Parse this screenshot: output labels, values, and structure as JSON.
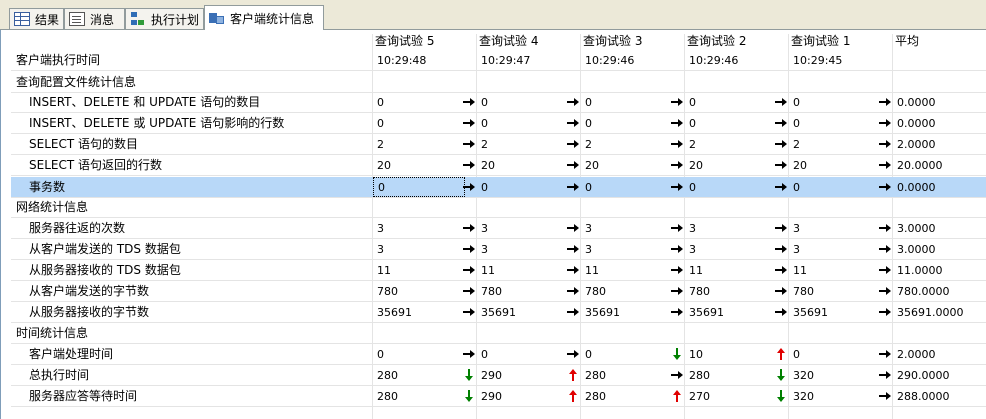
{
  "tabs": [
    {
      "label": "结果",
      "icon": "results-grid-icon"
    },
    {
      "label": "消息",
      "icon": "messages-icon"
    },
    {
      "label": "执行计划",
      "icon": "execution-plan-icon"
    },
    {
      "label": "客户端统计信息",
      "icon": "client-statistics-icon",
      "active": true
    }
  ],
  "columns": [
    "查询试验 5",
    "查询试验 4",
    "查询试验 3",
    "查询试验 2",
    "查询试验 1",
    "平均"
  ],
  "rows": [
    {
      "type": "top",
      "label": "客户端执行时间",
      "values": [
        "10:29:48",
        "10:29:47",
        "10:29:46",
        "10:29:46",
        "10:29:45",
        ""
      ],
      "arrows": [
        "",
        "",
        "",
        "",
        ""
      ]
    },
    {
      "type": "section",
      "label": "查询配置文件统计信息"
    },
    {
      "type": "data",
      "label": "INSERT、DELETE 和 UPDATE 语句的数目",
      "values": [
        "0",
        "0",
        "0",
        "0",
        "0",
        "0.0000"
      ],
      "arrows": [
        "right",
        "right",
        "right",
        "right",
        "right"
      ]
    },
    {
      "type": "data",
      "label": "INSERT、DELETE 或 UPDATE 语句影响的行数",
      "values": [
        "0",
        "0",
        "0",
        "0",
        "0",
        "0.0000"
      ],
      "arrows": [
        "right",
        "right",
        "right",
        "right",
        "right"
      ]
    },
    {
      "type": "data",
      "label": "SELECT 语句的数目",
      "values": [
        "2",
        "2",
        "2",
        "2",
        "2",
        "2.0000"
      ],
      "arrows": [
        "right",
        "right",
        "right",
        "right",
        "right"
      ]
    },
    {
      "type": "data",
      "label": "SELECT 语句返回的行数",
      "values": [
        "20",
        "20",
        "20",
        "20",
        "20",
        "20.0000"
      ],
      "arrows": [
        "right",
        "right",
        "right",
        "right",
        "right"
      ]
    },
    {
      "type": "data",
      "label": "事务数",
      "values": [
        "0",
        "0",
        "0",
        "0",
        "0",
        "0.0000"
      ],
      "arrows": [
        "right",
        "right",
        "right",
        "right",
        "right"
      ],
      "selected": true
    },
    {
      "type": "section",
      "label": "网络统计信息"
    },
    {
      "type": "data",
      "label": "服务器往返的次数",
      "values": [
        "3",
        "3",
        "3",
        "3",
        "3",
        "3.0000"
      ],
      "arrows": [
        "right",
        "right",
        "right",
        "right",
        "right"
      ]
    },
    {
      "type": "data",
      "label": "从客户端发送的 TDS 数据包",
      "values": [
        "3",
        "3",
        "3",
        "3",
        "3",
        "3.0000"
      ],
      "arrows": [
        "right",
        "right",
        "right",
        "right",
        "right"
      ]
    },
    {
      "type": "data",
      "label": "从服务器接收的 TDS 数据包",
      "values": [
        "11",
        "11",
        "11",
        "11",
        "11",
        "11.0000"
      ],
      "arrows": [
        "right",
        "right",
        "right",
        "right",
        "right"
      ]
    },
    {
      "type": "data",
      "label": "从客户端发送的字节数",
      "values": [
        "780",
        "780",
        "780",
        "780",
        "780",
        "780.0000"
      ],
      "arrows": [
        "right",
        "right",
        "right",
        "right",
        "right"
      ]
    },
    {
      "type": "data",
      "label": "从服务器接收的字节数",
      "values": [
        "35691",
        "35691",
        "35691",
        "35691",
        "35691",
        "35691.0000"
      ],
      "arrows": [
        "right",
        "right",
        "right",
        "right",
        "right"
      ]
    },
    {
      "type": "section",
      "label": "时间统计信息"
    },
    {
      "type": "data",
      "label": "客户端处理时间",
      "values": [
        "0",
        "0",
        "0",
        "10",
        "0",
        "2.0000"
      ],
      "arrows": [
        "right",
        "right",
        "down",
        "up",
        "right"
      ]
    },
    {
      "type": "data",
      "label": "总执行时间",
      "values": [
        "280",
        "290",
        "280",
        "280",
        "320",
        "290.0000"
      ],
      "arrows": [
        "down",
        "up",
        "right",
        "down",
        "right"
      ]
    },
    {
      "type": "data",
      "label": "服务器应答等待时间",
      "values": [
        "280",
        "290",
        "280",
        "270",
        "320",
        "288.0000"
      ],
      "arrows": [
        "down",
        "up",
        "up",
        "down",
        "right"
      ]
    }
  ],
  "colors": {
    "up": "#e00000",
    "down": "#008000",
    "right": "#000000",
    "selected": "#b8d8f8"
  }
}
